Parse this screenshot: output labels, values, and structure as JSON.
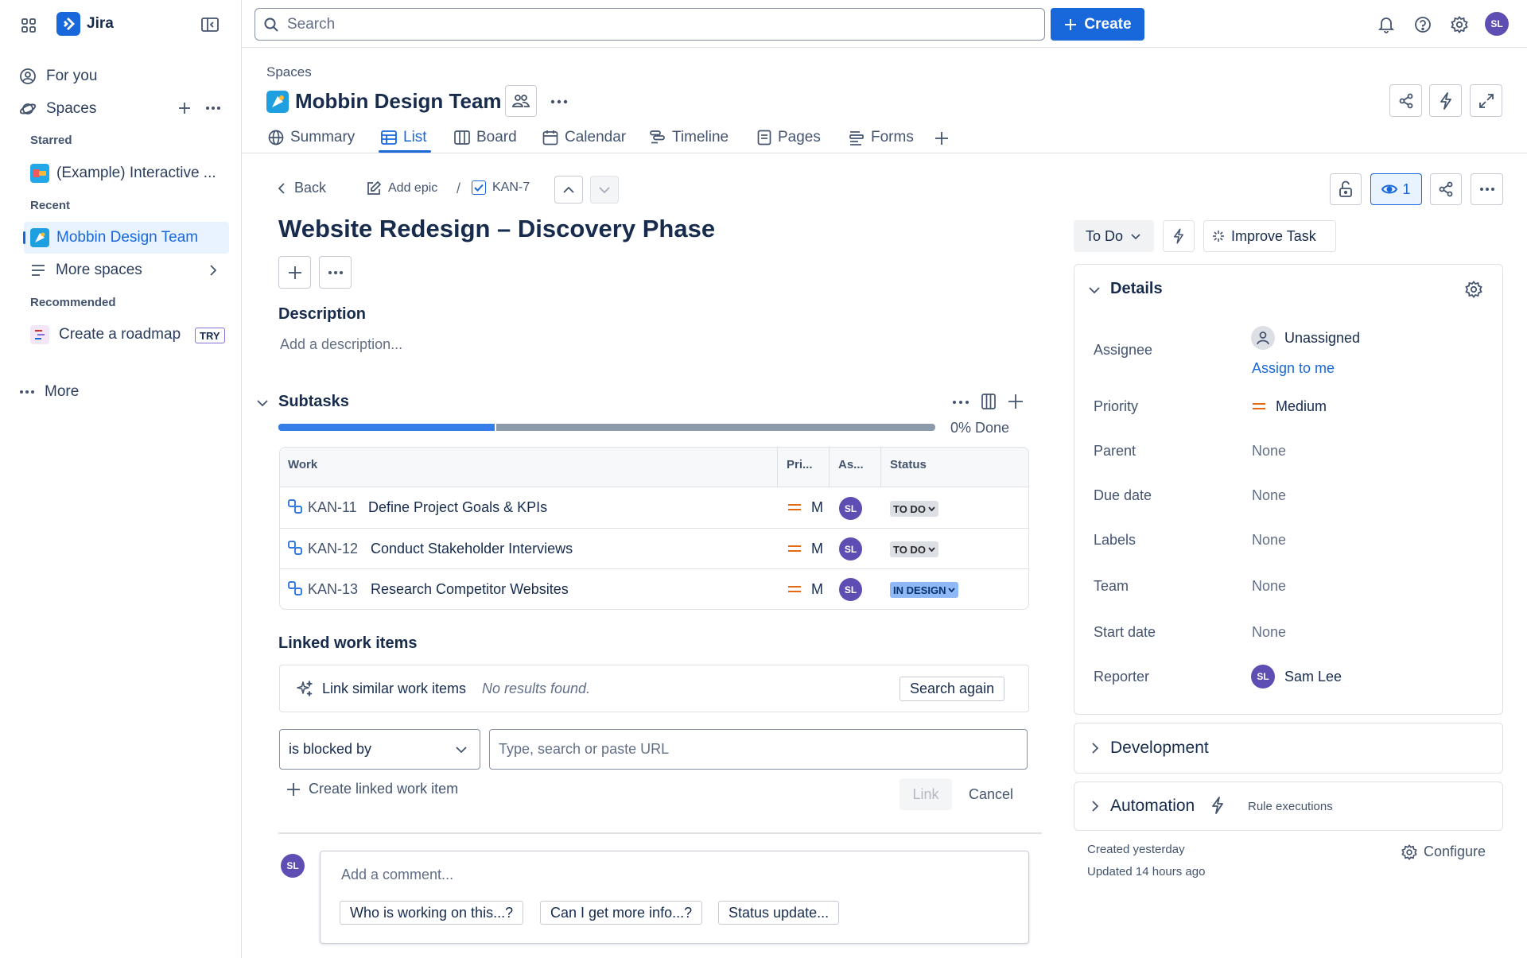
{
  "app": {
    "name": "Jira"
  },
  "sidebar": {
    "for_you": "For you",
    "spaces": "Spaces",
    "starred_heading": "Starred",
    "starred_item": "(Example) Interactive ...",
    "recent_heading": "Recent",
    "recent_item": "Mobbin Design Team",
    "more_spaces": "More spaces",
    "recommended_heading": "Recommended",
    "recommended_item": "Create a roadmap",
    "try_badge": "TRY",
    "more": "More"
  },
  "topbar": {
    "search_placeholder": "Search",
    "create_label": "Create",
    "avatar_initials": "SL"
  },
  "space": {
    "breadcrumb": "Spaces",
    "title": "Mobbin Design Team"
  },
  "tabs": [
    {
      "label": "Summary"
    },
    {
      "label": "List"
    },
    {
      "label": "Board"
    },
    {
      "label": "Calendar"
    },
    {
      "label": "Timeline"
    },
    {
      "label": "Pages"
    },
    {
      "label": "Forms"
    }
  ],
  "issue": {
    "back": "Back",
    "add_epic": "Add epic",
    "separator": "/",
    "key": "KAN-7",
    "watch_count": "1",
    "title": "Website Redesign – Discovery Phase",
    "description_heading": "Description",
    "description_placeholder": "Add a description..."
  },
  "subtasks": {
    "heading": "Subtasks",
    "progress_fraction": 0.0,
    "progress_text": "0% Done",
    "columns": [
      "Work",
      "Pri...",
      "As...",
      "Status"
    ],
    "rows": [
      {
        "key": "KAN-11",
        "summary": "Define Project Goals & KPIs",
        "priority": "M",
        "assignee": "SL",
        "status": "TO DO"
      },
      {
        "key": "KAN-12",
        "summary": "Conduct Stakeholder Interviews",
        "priority": "M",
        "assignee": "SL",
        "status": "TO DO"
      },
      {
        "key": "KAN-13",
        "summary": "Research Competitor Websites",
        "priority": "M",
        "assignee": "SL",
        "status": "IN DESIGN"
      }
    ]
  },
  "linked": {
    "heading": "Linked work items",
    "similar_label": "Link similar work items",
    "no_results": "No results found.",
    "search_again": "Search again",
    "relation_value": "is blocked by",
    "url_placeholder": "Type, search or paste URL",
    "create_linked": "Create linked work item",
    "link_button": "Link",
    "cancel_button": "Cancel"
  },
  "comment": {
    "avatar_initials": "SL",
    "placeholder": "Add a comment...",
    "suggestions": [
      "Who is working on this...?",
      "Can I get more info...?",
      "Status update..."
    ]
  },
  "right": {
    "status": "To Do",
    "improve_task": "Improve Task",
    "details_heading": "Details",
    "fields": {
      "assignee_label": "Assignee",
      "assignee_value": "Unassigned",
      "assign_to_me": "Assign to me",
      "priority_label": "Priority",
      "priority_value": "Medium",
      "parent_label": "Parent",
      "parent_value": "None",
      "due_label": "Due date",
      "due_value": "None",
      "labels_label": "Labels",
      "labels_value": "None",
      "team_label": "Team",
      "team_value": "None",
      "start_label": "Start date",
      "start_value": "None",
      "reporter_label": "Reporter",
      "reporter_initials": "SL",
      "reporter_value": "Sam Lee"
    },
    "development": "Development",
    "automation": "Automation",
    "rule_executions": "Rule executions",
    "created": "Created yesterday",
    "updated": "Updated 14 hours ago",
    "configure": "Configure"
  },
  "colors": {
    "brand_blue": "#1868db",
    "avatar_purple": "#5e4db2",
    "priority_orange": "#e56910",
    "in_design_blue": "#8fb8f6"
  }
}
